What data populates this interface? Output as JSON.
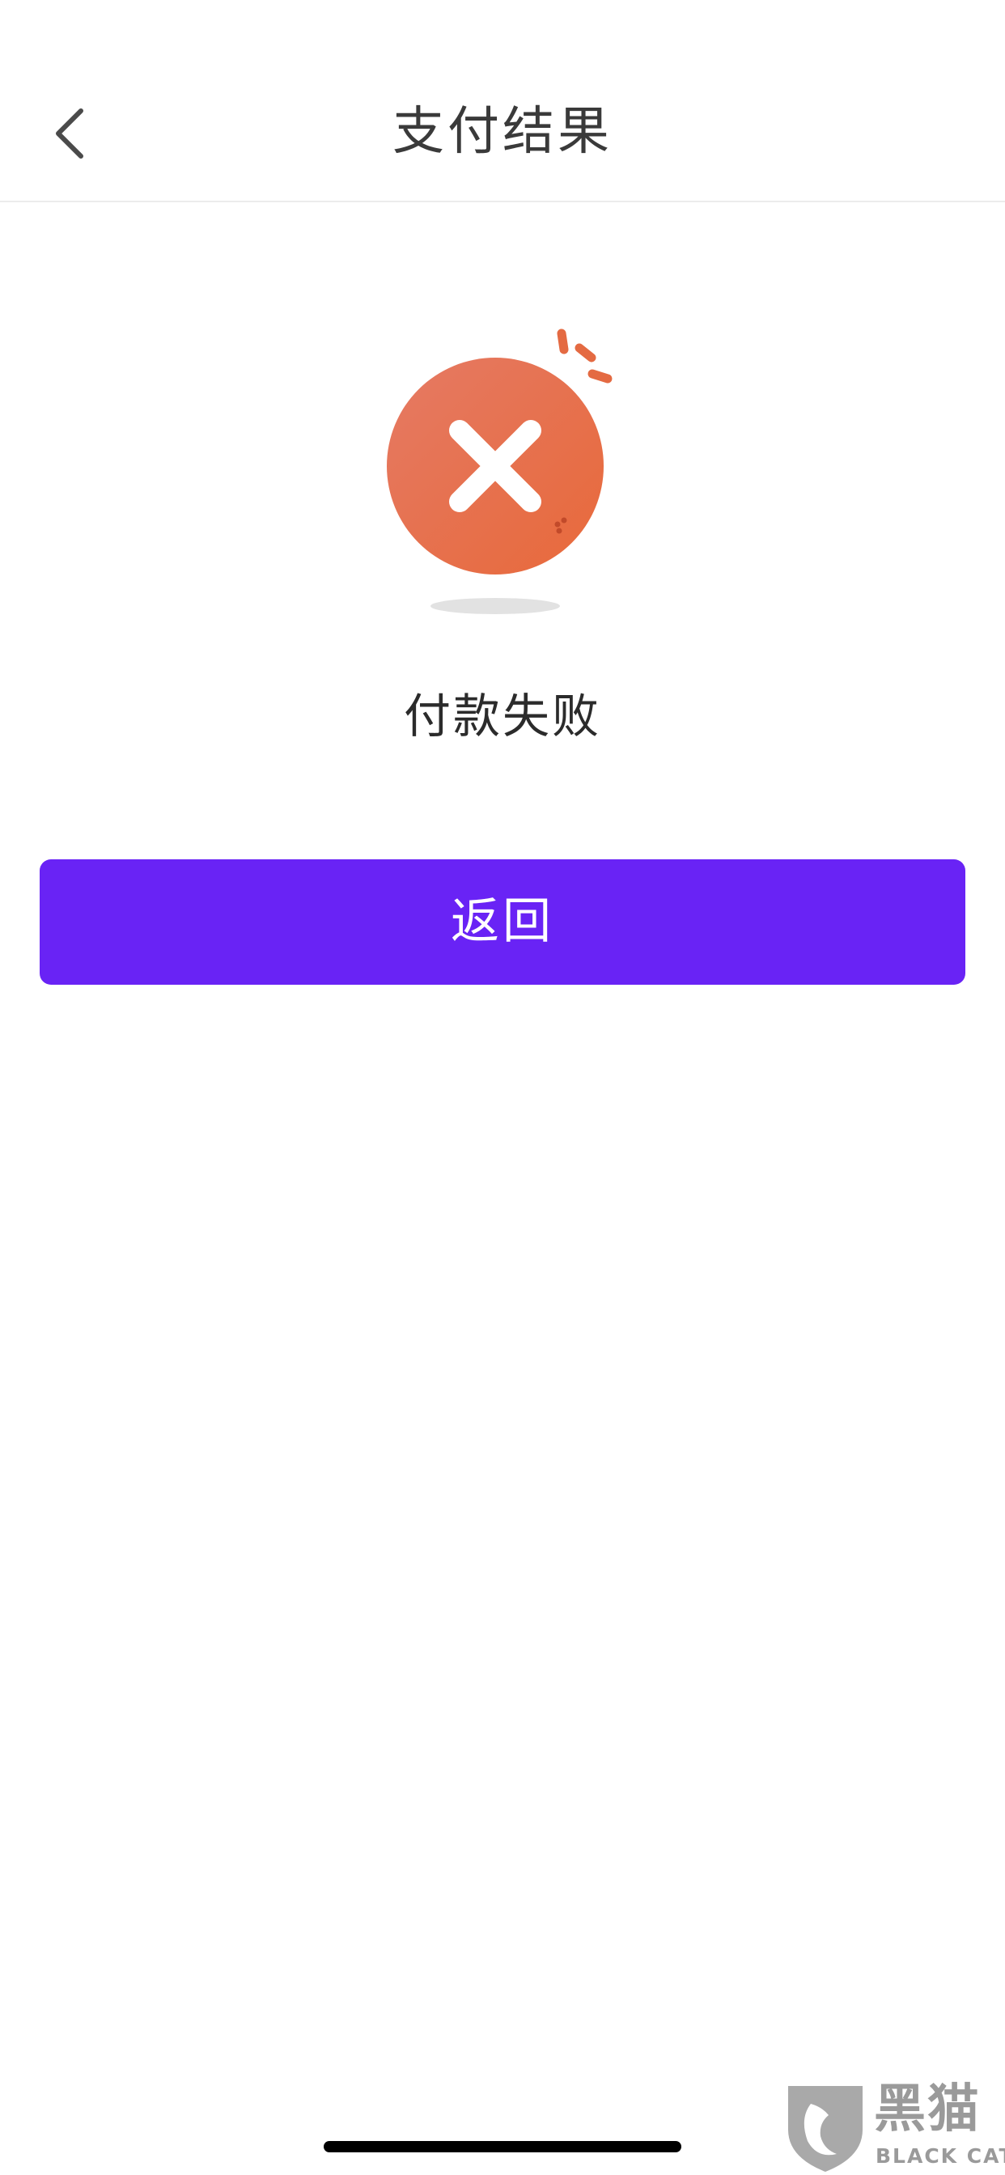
{
  "header": {
    "title": "支付结果",
    "back_icon": "chevron-left-icon"
  },
  "result": {
    "icon": "payment-failed-x-icon",
    "status_text": "付款失败",
    "icon_color": "#e8704d"
  },
  "actions": {
    "return_label": "返回"
  },
  "colors": {
    "primary_button": "#6923f5",
    "title_text": "#3a3a3a",
    "divider": "#ececec",
    "watermark": "#9a9a9a"
  },
  "watermark": {
    "title": "黑猫",
    "subtitle": "BLACK CAT",
    "icon": "cat-shield-icon"
  }
}
